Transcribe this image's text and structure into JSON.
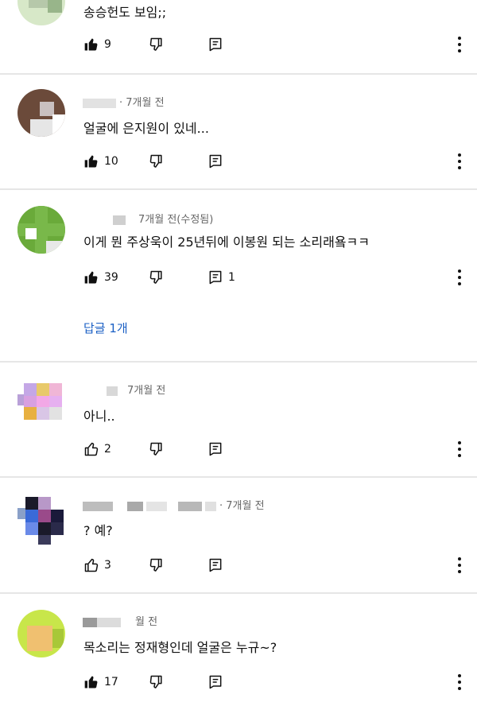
{
  "comments": [
    {
      "meta": "",
      "text": "송승헌도 보임;;",
      "likes": "9",
      "replies_count": ""
    },
    {
      "meta": "· 7개월 전",
      "text": "얼굴에 은지원이 있네...",
      "likes": "10",
      "replies_count": ""
    },
    {
      "meta": "7개월 전(수정됨)",
      "text": "이게 뭔 주상욱이 25년뒤에 이봉원 되는 소리래욬ㅋㅋ",
      "likes": "39",
      "replies_count": "1"
    },
    {
      "meta": "7개월 전",
      "text": "아니..",
      "likes": "2",
      "replies_count": ""
    },
    {
      "meta": "· 7개월 전",
      "text": "? 예?",
      "likes": "3",
      "replies_count": ""
    },
    {
      "meta": "월 전",
      "text": "목소리는 정재형인데 얼굴은 누규~?",
      "likes": "17",
      "replies_count": ""
    }
  ],
  "replies_link": "답글 1개",
  "colors": {
    "link": "#1a5fc4",
    "divider": "#e6e6e6",
    "text": "#111111",
    "meta": "#666666"
  },
  "icons": {
    "like_filled": "thumbs-up-filled-icon",
    "like_outline": "thumbs-up-outline-icon",
    "dislike": "thumbs-down-outline-icon",
    "reply": "reply-icon",
    "more": "more-vert-icon"
  }
}
